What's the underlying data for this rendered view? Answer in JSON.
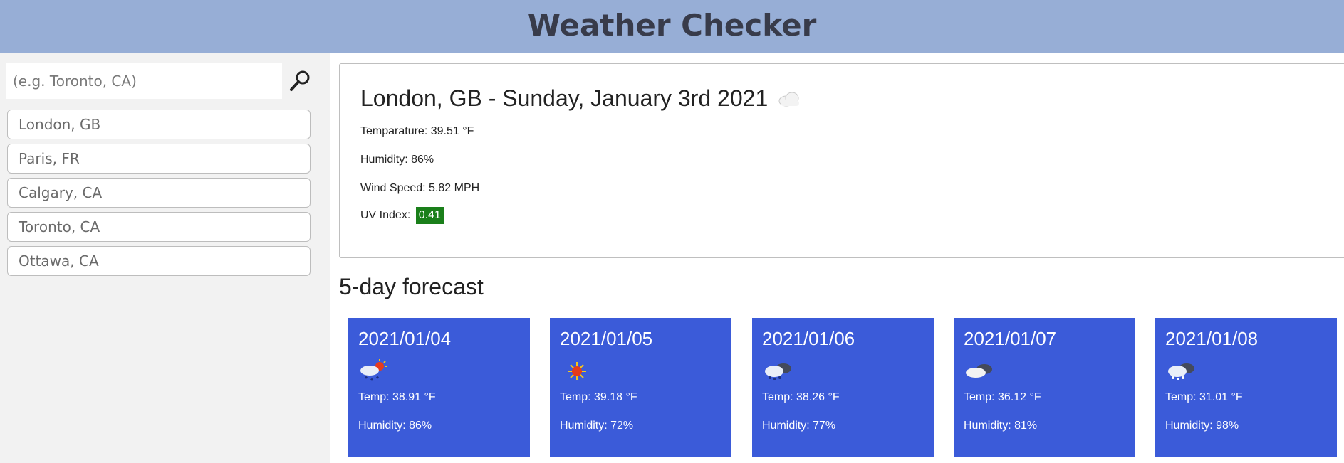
{
  "header": {
    "title": "Weather Checker"
  },
  "search": {
    "placeholder": "(e.g. Toronto, CA)",
    "button_icon": "search-icon"
  },
  "history": [
    {
      "label": "London, GB"
    },
    {
      "label": "Paris, FR"
    },
    {
      "label": "Calgary, CA"
    },
    {
      "label": "Toronto, CA"
    },
    {
      "label": "Ottawa, CA"
    }
  ],
  "current": {
    "title": "London, GB - Sunday, January 3rd 2021",
    "icon": "cloud-icon",
    "temperature": "Temparature: 39.51 °F",
    "humidity": "Humidity: 86%",
    "wind": "Wind Speed: 5.82 MPH",
    "uv_label": "UV Index:",
    "uv_value": "0.41",
    "uv_color": "#1a7f1a"
  },
  "forecast": {
    "title": "5-day forecast",
    "card_color": "#3b5bd9",
    "days": [
      {
        "date": "2021/01/04",
        "icon": "rain-sun-icon",
        "temp": "Temp: 38.91 °F",
        "humidity": "Humidity: 86%"
      },
      {
        "date": "2021/01/05",
        "icon": "sun-icon",
        "temp": "Temp: 39.18 °F",
        "humidity": "Humidity: 72%"
      },
      {
        "date": "2021/01/06",
        "icon": "snow-cloud-icon",
        "temp": "Temp: 38.26 °F",
        "humidity": "Humidity: 77%"
      },
      {
        "date": "2021/01/07",
        "icon": "cloud-icon",
        "temp": "Temp: 36.12 °F",
        "humidity": "Humidity: 81%"
      },
      {
        "date": "2021/01/08",
        "icon": "snow-cloud-icon",
        "temp": "Temp: 31.01 °F",
        "humidity": "Humidity: 98%"
      }
    ]
  }
}
